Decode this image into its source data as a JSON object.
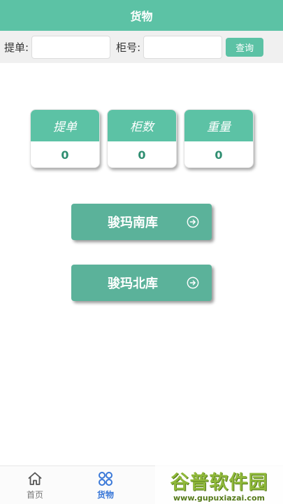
{
  "header": {
    "title": "货物"
  },
  "search": {
    "bill_label": "提单:",
    "container_label": "柜号:",
    "bill_value": "",
    "container_value": "",
    "query_label": "查询"
  },
  "stats": [
    {
      "title": "提单",
      "value": "0"
    },
    {
      "title": "柜数",
      "value": "0"
    },
    {
      "title": "重量",
      "value": "0"
    }
  ],
  "warehouses": {
    "south_label": "骏玛南库",
    "north_label": "骏玛北库",
    "arrow_icon": "arrow-circle-right-icon"
  },
  "tabbar": {
    "home_label": "首页",
    "goods_label": "货物",
    "active_color": "#3a78d8",
    "inactive_color": "#777777"
  },
  "colors": {
    "primary": "#5cc2a5",
    "button": "#5bb29a"
  },
  "watermark": {
    "main": "谷普软件园",
    "sub": "www.gupuxiazai.com"
  }
}
